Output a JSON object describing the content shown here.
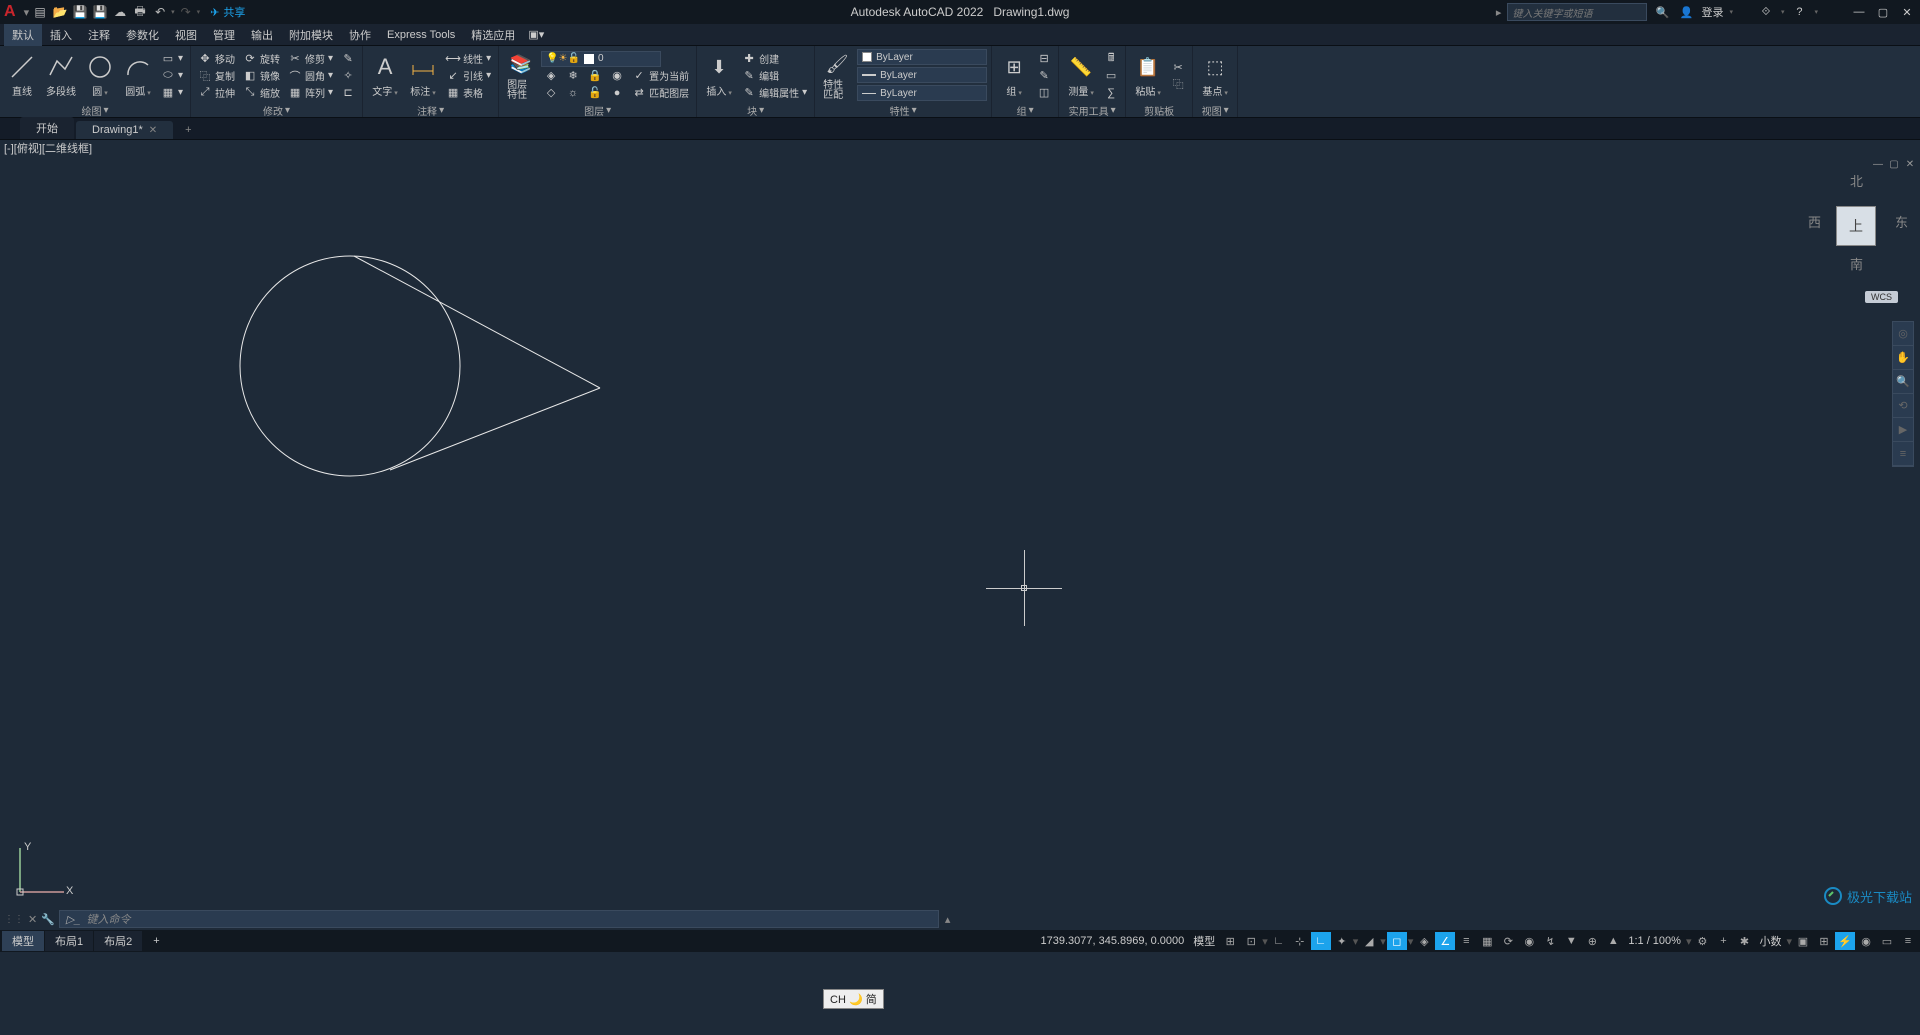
{
  "app": {
    "title": "Autodesk AutoCAD 2022",
    "filename": "Drawing1.dwg",
    "logo": "A"
  },
  "qat": {
    "share": "共享"
  },
  "search": {
    "placeholder": "键入关键字或短语",
    "login": "登录"
  },
  "menu": {
    "items": [
      "默认",
      "插入",
      "注释",
      "参数化",
      "视图",
      "管理",
      "输出",
      "附加模块",
      "协作",
      "Express Tools",
      "精选应用"
    ]
  },
  "ribbon": {
    "draw": {
      "label": "绘图",
      "line": "直线",
      "polyline": "多段线",
      "circle": "圆",
      "arc": "圆弧"
    },
    "modify": {
      "label": "修改",
      "move": "移动",
      "rotate": "旋转",
      "trim": "修剪",
      "copy": "复制",
      "mirror": "镜像",
      "fillet": "圆角",
      "stretch": "拉伸",
      "scale": "缩放",
      "array": "阵列"
    },
    "annotation": {
      "label": "注释",
      "text": "文字",
      "dim": "标注",
      "table": "表格",
      "linear": "线性",
      "leader": "引线"
    },
    "layers": {
      "label": "图层",
      "properties": "图层特性",
      "setcurrent": "置为当前",
      "match": "匹配图层",
      "layer0": "0"
    },
    "block": {
      "label": "块",
      "insert": "插入",
      "create": "创建",
      "edit": "编辑",
      "editattr": "编辑属性"
    },
    "properties": {
      "label": "特性",
      "match": "特性匹配",
      "bylayer": "ByLayer"
    },
    "groups": {
      "label": "组",
      "group": "组"
    },
    "utilities": {
      "label": "实用工具",
      "measure": "测量"
    },
    "clipboard": {
      "label": "剪贴板",
      "paste": "粘贴"
    },
    "view": {
      "label": "视图",
      "base": "基点"
    }
  },
  "file_tabs": {
    "start": "开始",
    "drawing": "Drawing1*"
  },
  "viewlabel": "[-][俯视][二维线框]",
  "viewcube": {
    "n": "北",
    "s": "南",
    "e": "东",
    "w": "西",
    "top": "上",
    "wcs": "WCS"
  },
  "cmdline": {
    "placeholder": "键入命令"
  },
  "ime": "CH 🌙 简",
  "model_tabs": {
    "model": "模型",
    "layout1": "布局1",
    "layout2": "布局2"
  },
  "status": {
    "coords": "1739.3077, 345.8969, 0.0000",
    "model": "模型",
    "scale": "1:1 / 100%",
    "decimal": "小数"
  },
  "watermark": "极光下载站"
}
